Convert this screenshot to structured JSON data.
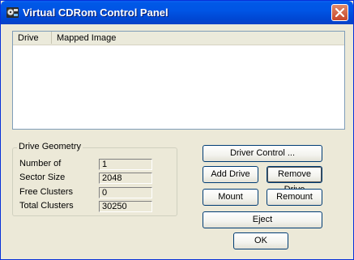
{
  "window": {
    "title": "Virtual CDRom Control Panel"
  },
  "listview": {
    "columns": [
      "Drive",
      "Mapped Image"
    ]
  },
  "geometry": {
    "title": "Drive Geometry",
    "rows": [
      {
        "label": "Number of",
        "value": "1"
      },
      {
        "label": "Sector Size",
        "value": "2048"
      },
      {
        "label": "Free Clusters",
        "value": "0"
      },
      {
        "label": "Total Clusters",
        "value": "30250"
      }
    ]
  },
  "buttons": {
    "driver_control": "Driver Control ...",
    "add_drive": "Add Drive",
    "remove_drive": "Remove Drive",
    "mount": "Mount",
    "remount": "Remount",
    "eject": "Eject",
    "ok": "OK"
  },
  "colors": {
    "titlebar": "#0055e5",
    "close": "#c8462a",
    "face": "#ece9d8"
  },
  "icons": {
    "app": "cd-drive-icon",
    "close": "close-icon"
  }
}
